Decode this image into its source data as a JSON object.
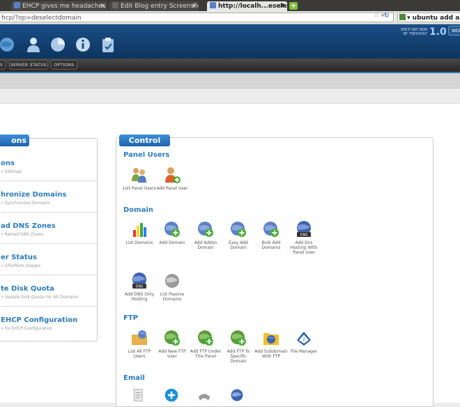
{
  "browser": {
    "tabs": [
      {
        "label": "EHCP gives me headaches - ...",
        "active": false
      },
      {
        "label": "Edit Blog entry Screenshots...",
        "active": false
      },
      {
        "label": "http://localh...eselectdomain",
        "active": true
      }
    ],
    "url": "hcp/?op=deselectdomain",
    "search": "ubuntu add applic"
  },
  "header": {
    "skin_line1": "EHCP SKY SKIN",
    "skin_line2": "BY TSKYHOST",
    "skin_version": "1.0",
    "web_button": "WEB",
    "icons": [
      "globe-icon",
      "user-icon",
      "pie-chart-icon",
      "info-icon",
      "clipboard-icon"
    ]
  },
  "nav": {
    "items": [
      "S",
      "SERVER STATUS",
      "OPTIONS"
    ]
  },
  "options": {
    "title": "ons",
    "items": [
      {
        "title": "ons",
        "subtitle": "» Settings"
      },
      {
        "title": "hronize Domains",
        "subtitle": "» Synchronize Domains"
      },
      {
        "title": "ad DNS Zones",
        "subtitle": "» Reload DNS Zones"
      },
      {
        "title": "er Status",
        "subtitle": "» CPU/Ram Usages"
      },
      {
        "title": "te Disk Quota",
        "subtitle": "» Update Disk Quota For All Domains"
      },
      {
        "title": "EHCP Configuration",
        "subtitle": "» Fix EHCP Configuration"
      }
    ]
  },
  "control_panel": {
    "title": "Control panel",
    "sections": [
      {
        "title": "Panel Users",
        "items": [
          "List Panel Users",
          "Add Panel User"
        ]
      },
      {
        "title": "Domain",
        "items": [
          "List Domains",
          "Add Domain",
          "Add Addon Domain",
          "Easy Add Domain",
          "Bulk Add Domains",
          "Add Dns Hosting With Panel User",
          "Add DNS Only Hosting",
          "List Passive Domains"
        ]
      },
      {
        "title": "FTP",
        "items": [
          "List All FTP Users",
          "Add New FTP User",
          "Add FTP Under This Panel",
          "Add FTP To Specific Domain",
          "Add Subdomain With FTP",
          "File Manager"
        ]
      },
      {
        "title": "Email",
        "items": [
          "",
          "",
          "",
          ""
        ]
      }
    ]
  }
}
